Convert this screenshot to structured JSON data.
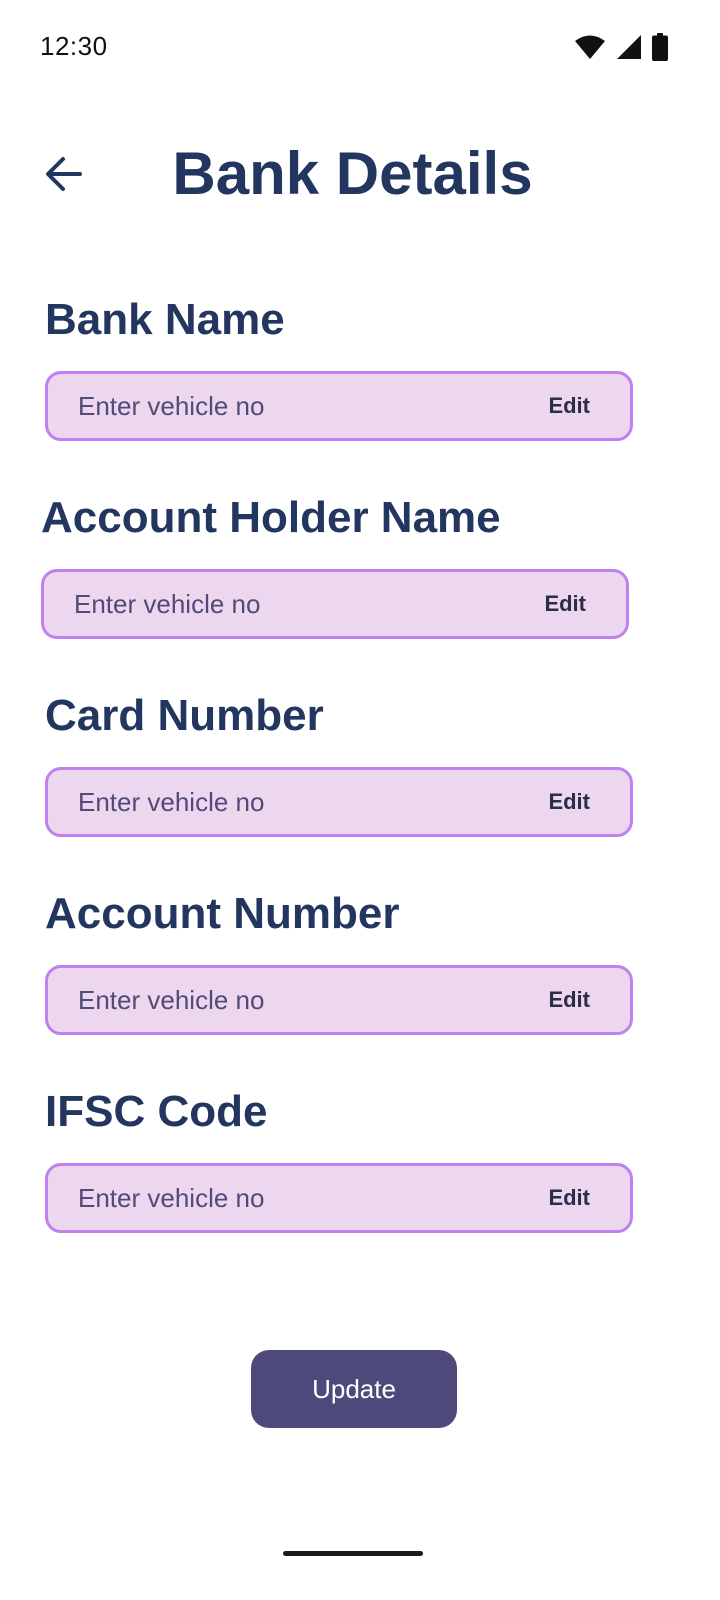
{
  "status_bar": {
    "time": "12:30",
    "icons": [
      "wifi-icon",
      "signal-icon",
      "battery-icon"
    ]
  },
  "header": {
    "back_icon": "arrow-left-icon",
    "title": "Bank Details"
  },
  "fields": [
    {
      "label": "Bank Name",
      "placeholder": "Enter vehicle no",
      "value": "",
      "action": "Edit"
    },
    {
      "label": "Account Holder Name",
      "placeholder": "Enter vehicle no",
      "value": "",
      "action": "Edit"
    },
    {
      "label": "Card Number",
      "placeholder": "Enter vehicle no",
      "value": "",
      "action": "Edit"
    },
    {
      "label": "Account Number",
      "placeholder": "Enter vehicle no",
      "value": "",
      "action": "Edit"
    },
    {
      "label": "IFSC Code",
      "placeholder": "Enter vehicle no",
      "value": "",
      "action": "Edit"
    }
  ],
  "update_button": {
    "label": "Update"
  },
  "colors": {
    "title": "#22365f",
    "field_border": "#c080f0",
    "field_fill": "#ecd7ef",
    "button": "#4d4a7b"
  }
}
